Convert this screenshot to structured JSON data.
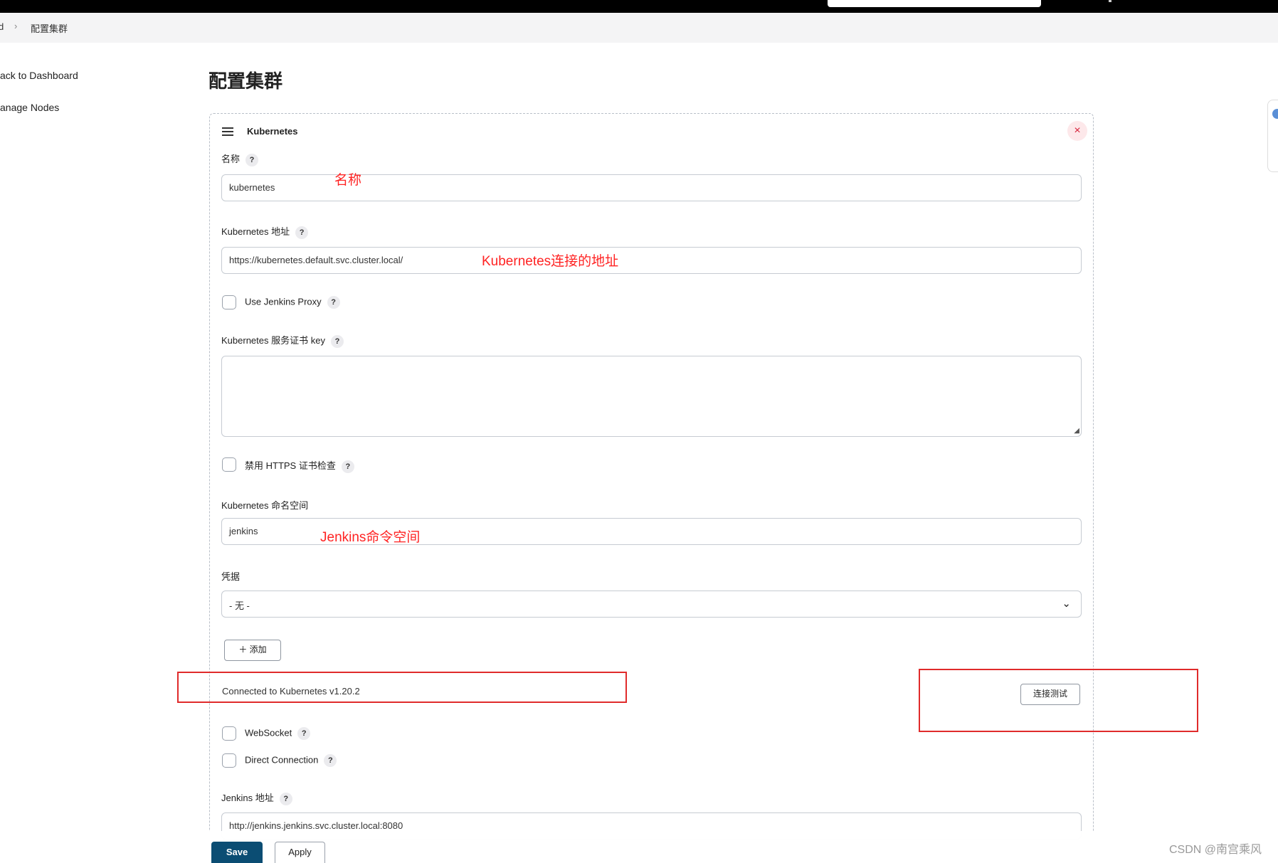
{
  "breadcrumb": {
    "prev": "d",
    "separator": "›",
    "current": "配置集群"
  },
  "sidebar": {
    "items": [
      {
        "label": "ack to Dashboard"
      },
      {
        "label": "anage Nodes"
      }
    ]
  },
  "page": {
    "title": "配置集群"
  },
  "cloud": {
    "title": "Kubernetes",
    "close_label": "×",
    "help_label": "?",
    "name": {
      "label": "名称",
      "value": "kubernetes"
    },
    "url": {
      "label": "Kubernetes 地址",
      "value": "https://kubernetes.default.svc.cluster.local/"
    },
    "use_proxy": {
      "label": "Use Jenkins Proxy",
      "checked": false
    },
    "server_cert": {
      "label": "Kubernetes 服务证书 key",
      "value": ""
    },
    "disable_https": {
      "label": "禁用 HTTPS 证书检查",
      "checked": false
    },
    "namespace": {
      "label": "Kubernetes 命名空间",
      "value": "jenkins"
    },
    "credentials": {
      "label": "凭据",
      "selected": "- 无 -",
      "add_label": "添加",
      "add_icon": "plus-icon"
    },
    "connection": {
      "status": "Connected to Kubernetes v1.20.2",
      "test_label": "连接测试"
    },
    "websocket": {
      "label": "WebSocket",
      "checked": false
    },
    "direct_connection": {
      "label": "Direct Connection",
      "checked": false
    },
    "jenkins_url": {
      "label": "Jenkins 地址",
      "value": "http://jenkins.jenkins.svc.cluster.local:8080"
    }
  },
  "annotations": {
    "name": "名称",
    "url": "Kubernetes连接的地址",
    "namespace": "Jenkins命令空间",
    "color": "#ff2323"
  },
  "actions": {
    "save": "Save",
    "apply": "Apply"
  },
  "watermark": "CSDN @南宫乘风",
  "colors": {
    "primary": "#0b4d73",
    "close": "#d6223a",
    "annotation": "#e02b2b"
  }
}
